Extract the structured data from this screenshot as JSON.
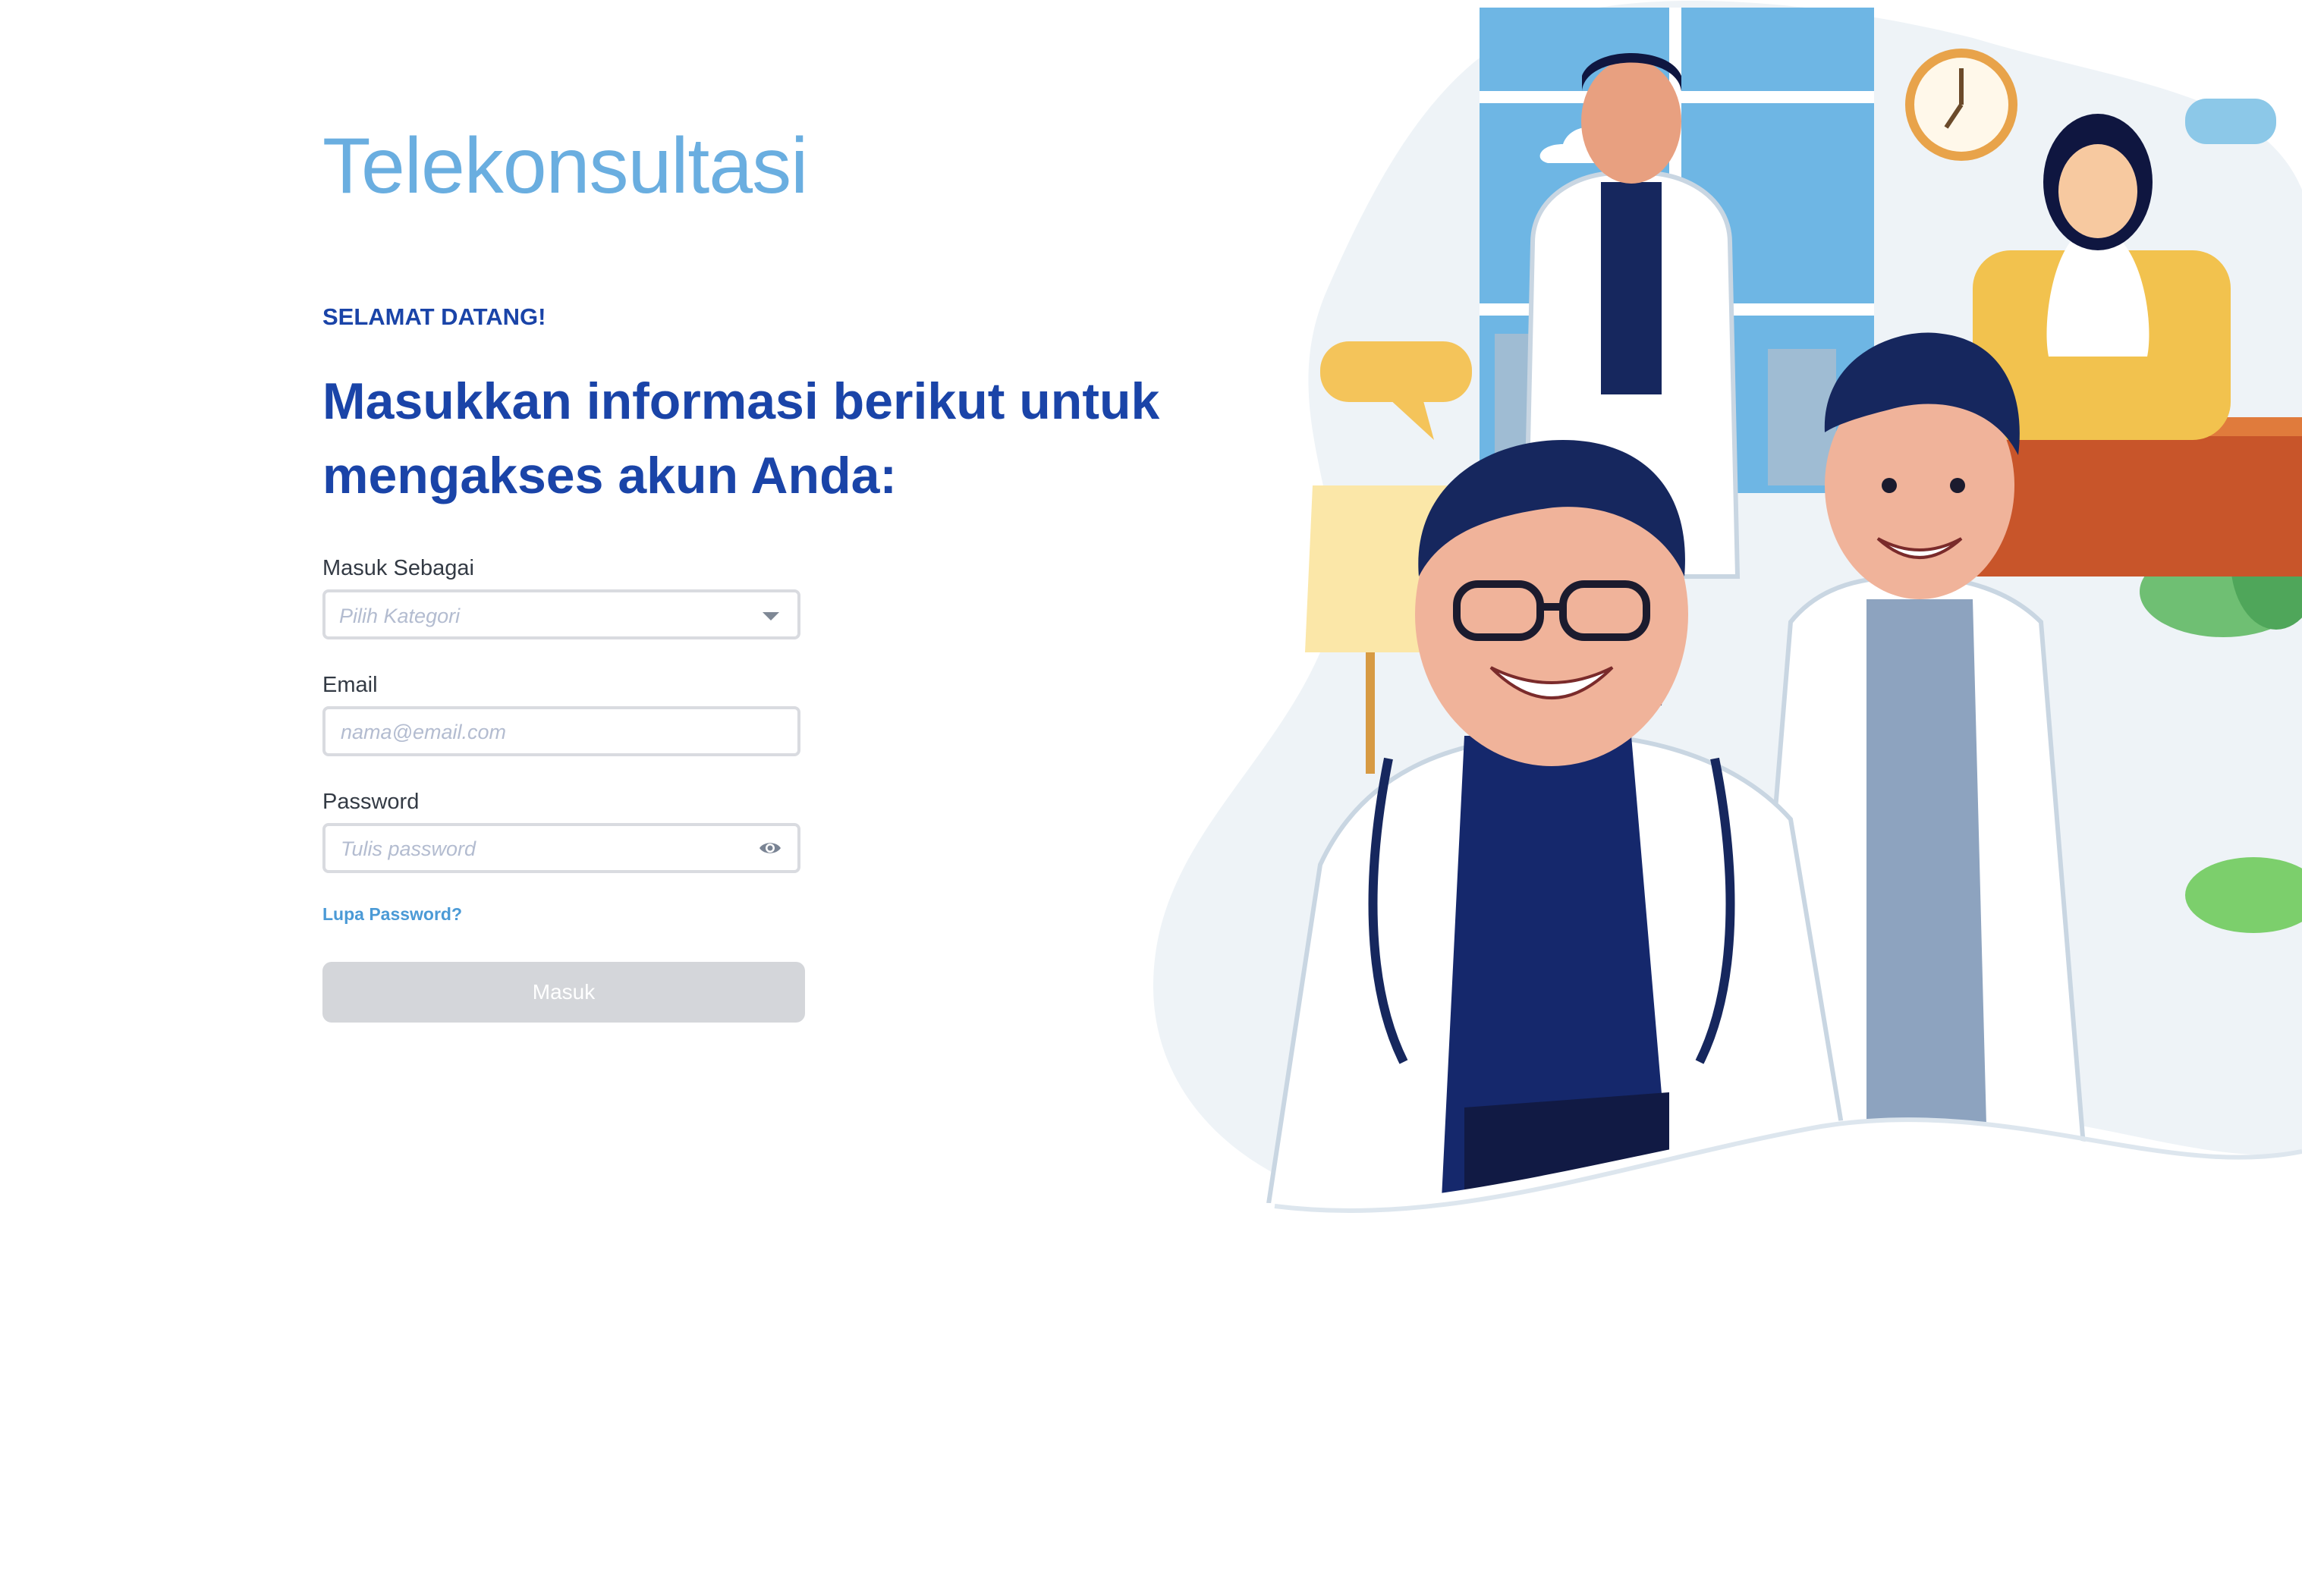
{
  "app": {
    "title": "Telekonsultasi"
  },
  "login": {
    "welcome": "SELAMAT DATANG!",
    "headline": "Masukkan informasi berikut untuk mengakses akun Anda:",
    "role_label": "Masuk Sebagai",
    "role_placeholder": "Pilih Kategori",
    "email_label": "Email",
    "email_placeholder": "nama@email.com",
    "password_label": "Password",
    "password_placeholder": "Tulis password",
    "forgot_label": "Lupa Password?",
    "submit_label": "Masuk"
  },
  "colors": {
    "brand_light": "#6aaee0",
    "brand_dark": "#1a44a8",
    "link": "#4b9ad6",
    "button_disabled": "#d4d6da"
  },
  "icons": {
    "role_select": "chevron-down-icon",
    "password_toggle": "eye-icon"
  },
  "illustration": {
    "subject": "doctors-illustration"
  }
}
